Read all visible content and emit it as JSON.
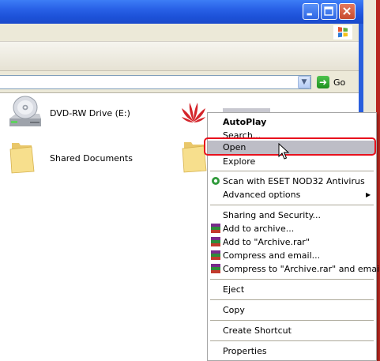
{
  "address": {
    "go_label": "Go"
  },
  "items": [
    {
      "label": "DVD-RW Drive (E:)"
    },
    {
      "label": "Shared Documents"
    }
  ],
  "context_menu": {
    "items": [
      {
        "label": "AutoPlay"
      },
      {
        "label": "Search..."
      },
      {
        "label": "Open"
      },
      {
        "label": "Explore"
      },
      {
        "label": "Scan with ESET NOD32 Antivirus"
      },
      {
        "label": "Advanced options"
      },
      {
        "label": "Sharing and Security..."
      },
      {
        "label": "Add to archive..."
      },
      {
        "label": "Add to \"Archive.rar\""
      },
      {
        "label": "Compress and email..."
      },
      {
        "label": "Compress to \"Archive.rar\" and email"
      },
      {
        "label": "Eject"
      },
      {
        "label": "Copy"
      },
      {
        "label": "Create Shortcut"
      },
      {
        "label": "Properties"
      }
    ]
  },
  "colors": {
    "selection_highlight": "#bdbdc6",
    "annotation_box": "#e8111d",
    "titlebar": "#2a63e8"
  }
}
